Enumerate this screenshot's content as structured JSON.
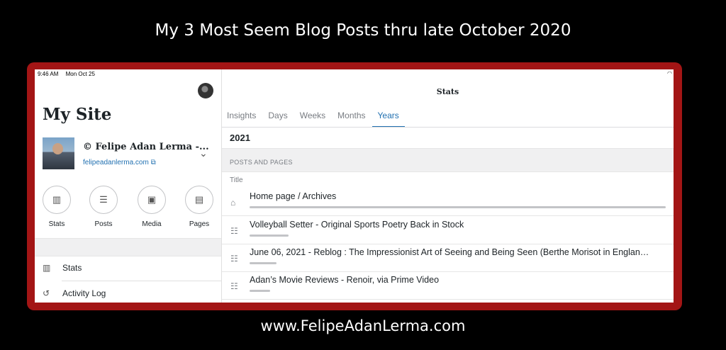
{
  "caption_top": "My 3 Most Seem Blog Posts thru late October 2020",
  "caption_bottom": "www.FelipeAdanLerma.com",
  "status": {
    "time": "9:46 AM",
    "date": "Mon Oct 25"
  },
  "sidebar": {
    "title": "My Site",
    "site_name": "© Felipe Adan Lerma -...",
    "site_url": "felipeadanlerma.com",
    "quick_actions": [
      {
        "label": "Stats",
        "icon": "bar-chart-icon"
      },
      {
        "label": "Posts",
        "icon": "posts-icon"
      },
      {
        "label": "Media",
        "icon": "image-icon"
      },
      {
        "label": "Pages",
        "icon": "pages-icon"
      }
    ],
    "menu": [
      {
        "label": "Stats",
        "icon": "bar-chart-icon"
      },
      {
        "label": "Activity Log",
        "icon": "history-icon"
      }
    ]
  },
  "main": {
    "title": "Stats",
    "tabs": [
      "Insights",
      "Days",
      "Weeks",
      "Months",
      "Years"
    ],
    "active_tab": "Years",
    "period": "2021",
    "section_header": "POSTS AND PAGES",
    "column_title": "Title",
    "rows": [
      {
        "title": "Home page / Archives",
        "icon": "home-icon",
        "share": 1.0
      },
      {
        "title": "Volleyball Setter - Original Sports Poetry Back in Stock",
        "icon": "post-icon",
        "share": 0.094
      },
      {
        "title": "June 06, 2021 - Reblog : The Impressionist Art of Seeing and Being Seen (Berthe Morisot in Englan…",
        "icon": "post-icon",
        "share": 0.064
      },
      {
        "title": "Adan’s Movie Reviews - Renoir, via Prime Video",
        "icon": "post-icon",
        "share": 0.049
      }
    ]
  }
}
